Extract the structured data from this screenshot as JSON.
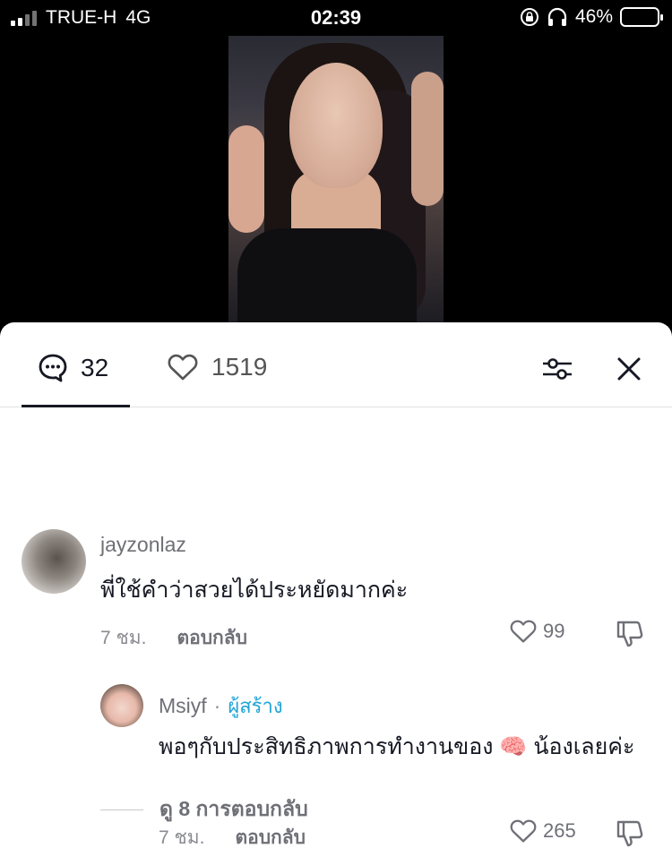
{
  "status_bar": {
    "carrier": "TRUE-H",
    "network": "4G",
    "time": "02:39",
    "battery": "46%",
    "battery_level": 0.46
  },
  "tabs": {
    "comments_count": "32",
    "likes_count": "1519"
  },
  "comments": [
    {
      "username": "jayzonlaz",
      "text": "พี่ใช้คำว่าสวยได้ประหยัดมากค่ะ",
      "time": "7 ชม.",
      "reply_label": "ตอบกลับ",
      "likes": "99"
    }
  ],
  "reply": {
    "username": "Msiyf",
    "separator": "·",
    "creator_label": "ผู้สร้าง",
    "text": "พอๆกับประสิทธิภาพการทำงานของ 🧠 น้องเลยค่ะ",
    "time": "7 ชม.",
    "reply_label": "ตอบกลับ",
    "likes": "265"
  },
  "view_replies": "ดู 8 การตอบกลับ",
  "colors": {
    "creator_accent": "#20a4d6",
    "text_primary": "#161823",
    "text_secondary": "#8a8b91"
  }
}
